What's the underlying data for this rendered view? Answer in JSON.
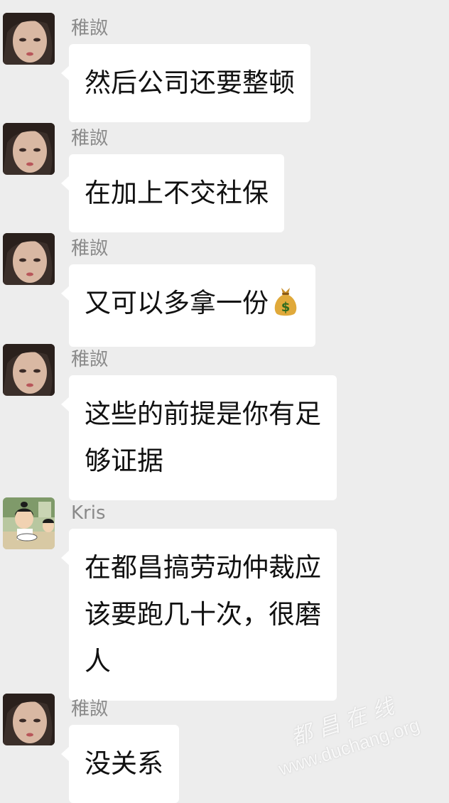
{
  "messages": [
    {
      "sender": "稚詉",
      "text": "然后公司还要整顿",
      "avatar": "girl-avatar"
    },
    {
      "sender": "稚詉",
      "text": "在加上不交社保",
      "avatar": "girl-avatar"
    },
    {
      "sender": "稚詉",
      "text": "又可以多拿一份",
      "emoji": "money-bag-icon",
      "avatar": "girl-avatar"
    },
    {
      "sender": "稚詉",
      "text": "这些的前提是你有足\n够证据",
      "avatar": "girl-avatar"
    },
    {
      "sender": "Kris",
      "text": "在都昌搞劳动仲裁应\n该要跑几十次，很磨\n人",
      "avatar": "cartoon-avatar"
    },
    {
      "sender": "稚詉",
      "text": "没关系",
      "avatar": "girl-avatar"
    }
  ],
  "watermark": {
    "chinese": "都昌在线",
    "url": "www.duchang.org"
  },
  "colors": {
    "background": "#ededed",
    "bubble": "#ffffff",
    "sender_name": "#8a8a8a",
    "text": "#111111"
  }
}
